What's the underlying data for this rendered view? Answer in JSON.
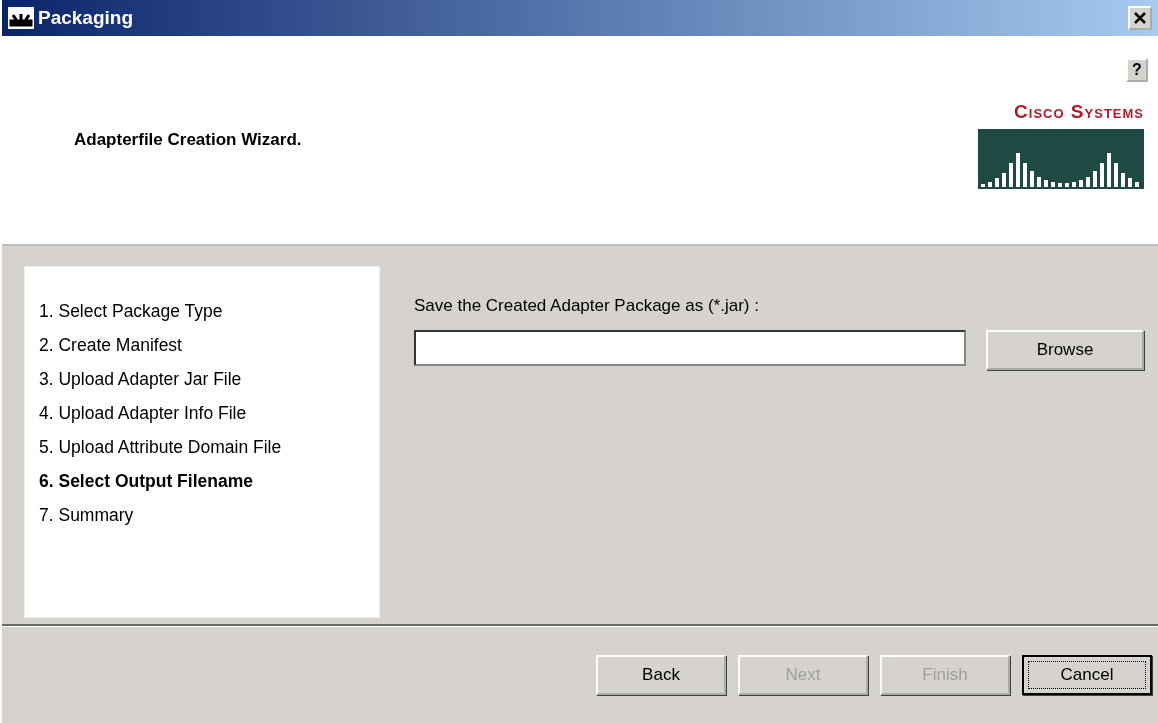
{
  "window": {
    "title": "Packaging"
  },
  "header": {
    "help": "?",
    "title": "Adapterfile Creation Wizard.",
    "logo_text": "Cisco Systems"
  },
  "steps": [
    {
      "label": "1. Select Package Type",
      "selected": false
    },
    {
      "label": "2. Create Manifest",
      "selected": false
    },
    {
      "label": "3. Upload Adapter Jar File",
      "selected": false
    },
    {
      "label": "4. Upload Adapter Info File",
      "selected": false
    },
    {
      "label": "5. Upload Attribute Domain File",
      "selected": false
    },
    {
      "label": "6. Select Output Filename",
      "selected": true
    },
    {
      "label": "7. Summary",
      "selected": false
    }
  ],
  "form": {
    "label": "Save the Created Adapter Package as (*.jar) :",
    "browse": "Browse"
  },
  "buttons": [
    {
      "label": "Back",
      "disabled": false,
      "focused": false
    },
    {
      "label": "Next",
      "disabled": true,
      "focused": false
    },
    {
      "label": "Finish",
      "disabled": true,
      "focused": false
    },
    {
      "label": "Cancel",
      "disabled": false,
      "focused": true
    }
  ]
}
